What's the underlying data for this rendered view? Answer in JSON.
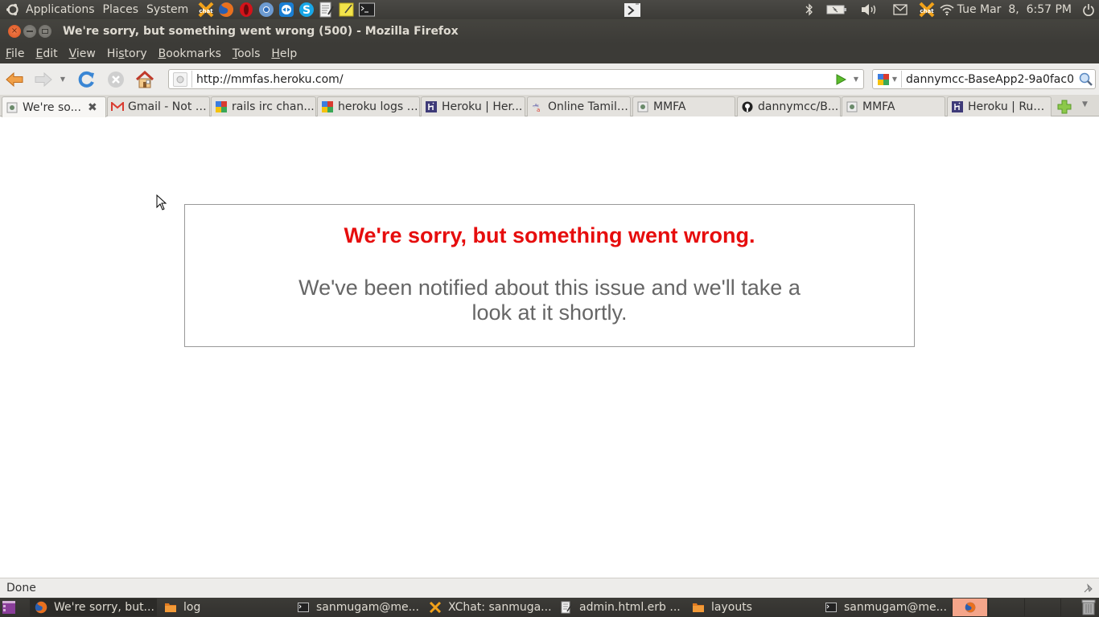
{
  "top_panel": {
    "menus": [
      "Applications",
      "Places",
      "System"
    ],
    "launchers": [
      {
        "name": "xchat-launcher",
        "icon": "xchat-icon"
      },
      {
        "name": "firefox-launcher",
        "icon": "firefox-icon"
      },
      {
        "name": "opera-launcher",
        "icon": "opera-icon"
      },
      {
        "name": "chromium-launcher",
        "icon": "chromium-icon"
      },
      {
        "name": "teamviewer-launcher",
        "icon": "teamviewer-icon"
      },
      {
        "name": "skype-launcher",
        "icon": "skype-icon"
      },
      {
        "name": "text-editor-launcher",
        "icon": "text-editor-icon"
      },
      {
        "name": "notes-launcher",
        "icon": "sticky-notes-icon"
      },
      {
        "name": "terminal-launcher",
        "icon": "terminal-icon"
      }
    ],
    "clock": "Tue Mar  8,  6:57 PM"
  },
  "window": {
    "title": "We're sorry, but something went wrong (500) - Mozilla Firefox"
  },
  "menubar": {
    "items": [
      {
        "label": "File",
        "key": "F",
        "rest": "ile"
      },
      {
        "label": "Edit",
        "key": "E",
        "rest": "dit"
      },
      {
        "label": "View",
        "key": "V",
        "rest": "iew"
      },
      {
        "label": "History",
        "pre": "Hi",
        "key": "s",
        "rest": "tory"
      },
      {
        "label": "Bookmarks",
        "key": "B",
        "rest": "ookmarks"
      },
      {
        "label": "Tools",
        "key": "T",
        "rest": "ools"
      },
      {
        "label": "Help",
        "key": "H",
        "rest": "elp"
      }
    ]
  },
  "navbar": {
    "url": "http://mmfas.heroku.com/",
    "search_query": "dannymcc-BaseApp2-9a0fac0"
  },
  "tabs": [
    {
      "label": "We're so...",
      "favicon": "page-icon",
      "active": true
    },
    {
      "label": "Gmail - Not r...",
      "favicon": "gmail-icon"
    },
    {
      "label": "rails irc chan...",
      "favicon": "google-icon"
    },
    {
      "label": "heroku logs -...",
      "favicon": "google-icon"
    },
    {
      "label": "Heroku | Her...",
      "favicon": "heroku-icon"
    },
    {
      "label": "Online Tamil ...",
      "favicon": "tamil-icon"
    },
    {
      "label": "MMFA",
      "favicon": "page-icon"
    },
    {
      "label": "dannymcc/B...",
      "favicon": "github-icon"
    },
    {
      "label": "MMFA",
      "favicon": "page-icon"
    },
    {
      "label": "Heroku | Rub...",
      "favicon": "heroku-icon"
    }
  ],
  "content": {
    "error_title": "We're sorry, but something went wrong.",
    "error_message": "We've been notified about this issue and we'll take a look at it shortly.",
    "title_color": "#e60d0d",
    "message_color": "#666666"
  },
  "statusbar": {
    "text": "Done"
  },
  "taskbar": {
    "tasks": [
      {
        "label": "We're sorry, but...",
        "icon": "firefox-icon",
        "active": true
      },
      {
        "label": "log",
        "icon": "folder-icon"
      },
      {
        "label": "sanmugam@me...",
        "icon": "terminal-icon"
      },
      {
        "label": "XChat: sanmuga...",
        "icon": "xchat-icon"
      },
      {
        "label": "admin.html.erb ...",
        "icon": "text-editor-icon"
      },
      {
        "label": "layouts",
        "icon": "folder-icon"
      },
      {
        "label": "sanmugam@me...",
        "icon": "terminal-icon"
      }
    ]
  }
}
